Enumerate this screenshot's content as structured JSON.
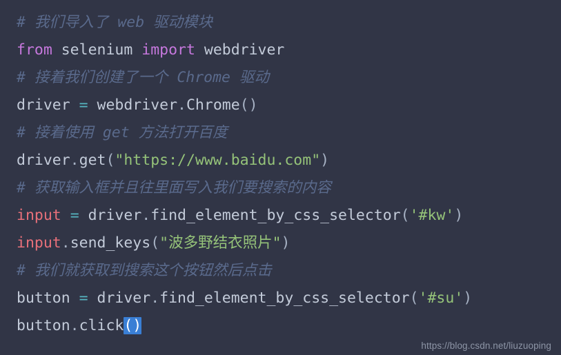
{
  "editor": {
    "language": "python",
    "background_color": "#313546",
    "colors": {
      "comment": "#5a6a8c",
      "keyword": "#c678dd",
      "plain": "#c3cbd9",
      "builtin": "#e8707a",
      "operator": "#56b6c2",
      "string": "#95c379",
      "punctuation": "#a7b2c4",
      "selection": "#3a7fd5"
    },
    "lines": [
      {
        "type": "comment",
        "text": "# 我们导入了 web 驱动模块",
        "tokens": [
          {
            "t": "# 我们导入了 web 驱动模块",
            "c": "comment"
          }
        ]
      },
      {
        "type": "code",
        "text": "from selenium import webdriver",
        "tokens": [
          {
            "t": "from",
            "c": "keyword"
          },
          {
            "t": " ",
            "c": "plain"
          },
          {
            "t": "selenium",
            "c": "plain"
          },
          {
            "t": " ",
            "c": "plain"
          },
          {
            "t": "import",
            "c": "keyword"
          },
          {
            "t": " ",
            "c": "plain"
          },
          {
            "t": "webdriver",
            "c": "plain"
          }
        ]
      },
      {
        "type": "comment",
        "text": "# 接着我们创建了一个 Chrome 驱动",
        "tokens": [
          {
            "t": "# 接着我们创建了一个 Chrome 驱动",
            "c": "comment"
          }
        ]
      },
      {
        "type": "code",
        "text": "driver = webdriver.Chrome()",
        "tokens": [
          {
            "t": "driver",
            "c": "plain"
          },
          {
            "t": " ",
            "c": "plain"
          },
          {
            "t": "=",
            "c": "operator"
          },
          {
            "t": " ",
            "c": "plain"
          },
          {
            "t": "webdriver",
            "c": "plain"
          },
          {
            "t": ".",
            "c": "punct"
          },
          {
            "t": "Chrome",
            "c": "plain"
          },
          {
            "t": "()",
            "c": "punct"
          }
        ]
      },
      {
        "type": "comment",
        "text": "# 接着使用 get 方法打开百度",
        "tokens": [
          {
            "t": "# 接着使用 get 方法打开百度",
            "c": "comment"
          }
        ]
      },
      {
        "type": "code",
        "text": "driver.get(\"https://www.baidu.com\")",
        "tokens": [
          {
            "t": "driver",
            "c": "plain"
          },
          {
            "t": ".",
            "c": "punct"
          },
          {
            "t": "get",
            "c": "plain"
          },
          {
            "t": "(",
            "c": "punct"
          },
          {
            "t": "\"https://www.baidu.com\"",
            "c": "string"
          },
          {
            "t": ")",
            "c": "punct"
          }
        ]
      },
      {
        "type": "comment",
        "text": "# 获取输入框并且往里面写入我们要搜索的内容",
        "tokens": [
          {
            "t": "# 获取输入框并且往里面写入我们要搜索的内容",
            "c": "comment"
          }
        ]
      },
      {
        "type": "code",
        "text": "input = driver.find_element_by_css_selector('#kw')",
        "tokens": [
          {
            "t": "input",
            "c": "builtin"
          },
          {
            "t": " ",
            "c": "plain"
          },
          {
            "t": "=",
            "c": "operator"
          },
          {
            "t": " ",
            "c": "plain"
          },
          {
            "t": "driver",
            "c": "plain"
          },
          {
            "t": ".",
            "c": "punct"
          },
          {
            "t": "find_element_by_css_selector",
            "c": "plain"
          },
          {
            "t": "(",
            "c": "punct"
          },
          {
            "t": "'#kw'",
            "c": "string"
          },
          {
            "t": ")",
            "c": "punct"
          }
        ]
      },
      {
        "type": "code",
        "text": "input.send_keys(\"波多野结衣照片\")",
        "tokens": [
          {
            "t": "input",
            "c": "builtin"
          },
          {
            "t": ".",
            "c": "punct"
          },
          {
            "t": "send_keys",
            "c": "plain"
          },
          {
            "t": "(",
            "c": "punct"
          },
          {
            "t": "\"波多野结衣照片\"",
            "c": "string"
          },
          {
            "t": ")",
            "c": "punct"
          }
        ]
      },
      {
        "type": "comment",
        "text": "# 我们就获取到搜索这个按钮然后点击",
        "tokens": [
          {
            "t": "# 我们就获取到搜索这个按钮然后点击",
            "c": "comment"
          }
        ]
      },
      {
        "type": "code",
        "text": "button = driver.find_element_by_css_selector('#su')",
        "tokens": [
          {
            "t": "button",
            "c": "plain"
          },
          {
            "t": " ",
            "c": "plain"
          },
          {
            "t": "=",
            "c": "operator"
          },
          {
            "t": " ",
            "c": "plain"
          },
          {
            "t": "driver",
            "c": "plain"
          },
          {
            "t": ".",
            "c": "punct"
          },
          {
            "t": "find_element_by_css_selector",
            "c": "plain"
          },
          {
            "t": "(",
            "c": "punct"
          },
          {
            "t": "'#su'",
            "c": "string"
          },
          {
            "t": ")",
            "c": "punct"
          }
        ]
      },
      {
        "type": "code",
        "text": "button.click()",
        "tokens": [
          {
            "t": "button",
            "c": "plain"
          },
          {
            "t": ".",
            "c": "punct"
          },
          {
            "t": "click",
            "c": "plain"
          },
          {
            "t": "()",
            "c": "sel"
          }
        ]
      }
    ]
  },
  "watermark": {
    "text": "https://blog.csdn.net/liuzuoping"
  }
}
